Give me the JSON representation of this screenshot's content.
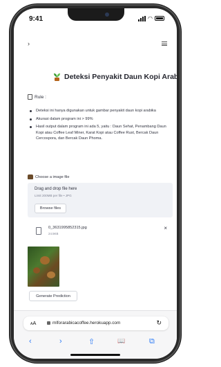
{
  "status": {
    "time": "9:41"
  },
  "nav": {
    "back": "›"
  },
  "page": {
    "title": "Deteksi Penyakit Daun Kopi Arabika",
    "rule_label": "Rule :",
    "rules": [
      "Deteksi ini hanya digunakan untuk gambar penyakit daun kopi arabika",
      "Akurasi dalam program ini > 99%",
      "Hasil output dalam program ini ada 5, yaitu : Daun Sehat, Penambang Daun Kopi atau Coffee Leaf Miner, Karat Kopi atau Coffee Rust, Bercak Daun Cercospora, dan Bercak Daun Phoma."
    ],
    "file_label": "Choose a image file"
  },
  "uploader": {
    "title": "Drag and drop file here",
    "limit": "Limit 200MB per file • JPG",
    "browse_label": "Browse files",
    "file_name": "0_3631995852315.jpg",
    "file_size": "24.5KB",
    "remove": "×"
  },
  "actions": {
    "generate_label": "Generate Prediction"
  },
  "browser": {
    "aa_big": "A",
    "aa_small": "A",
    "url": "mlforarabicacoffee.herokuapp.com",
    "reload": "↻",
    "toolbar": {
      "back": "‹",
      "forward": "›",
      "share": "⇧",
      "bookmarks": "📖",
      "tabs": "⧉"
    }
  },
  "icons": [
    "plant-icon",
    "document-icon",
    "image-icon",
    "file-icon",
    "lock-icon",
    "reload-icon",
    "share-icon",
    "book-icon",
    "tabs-icon"
  ]
}
